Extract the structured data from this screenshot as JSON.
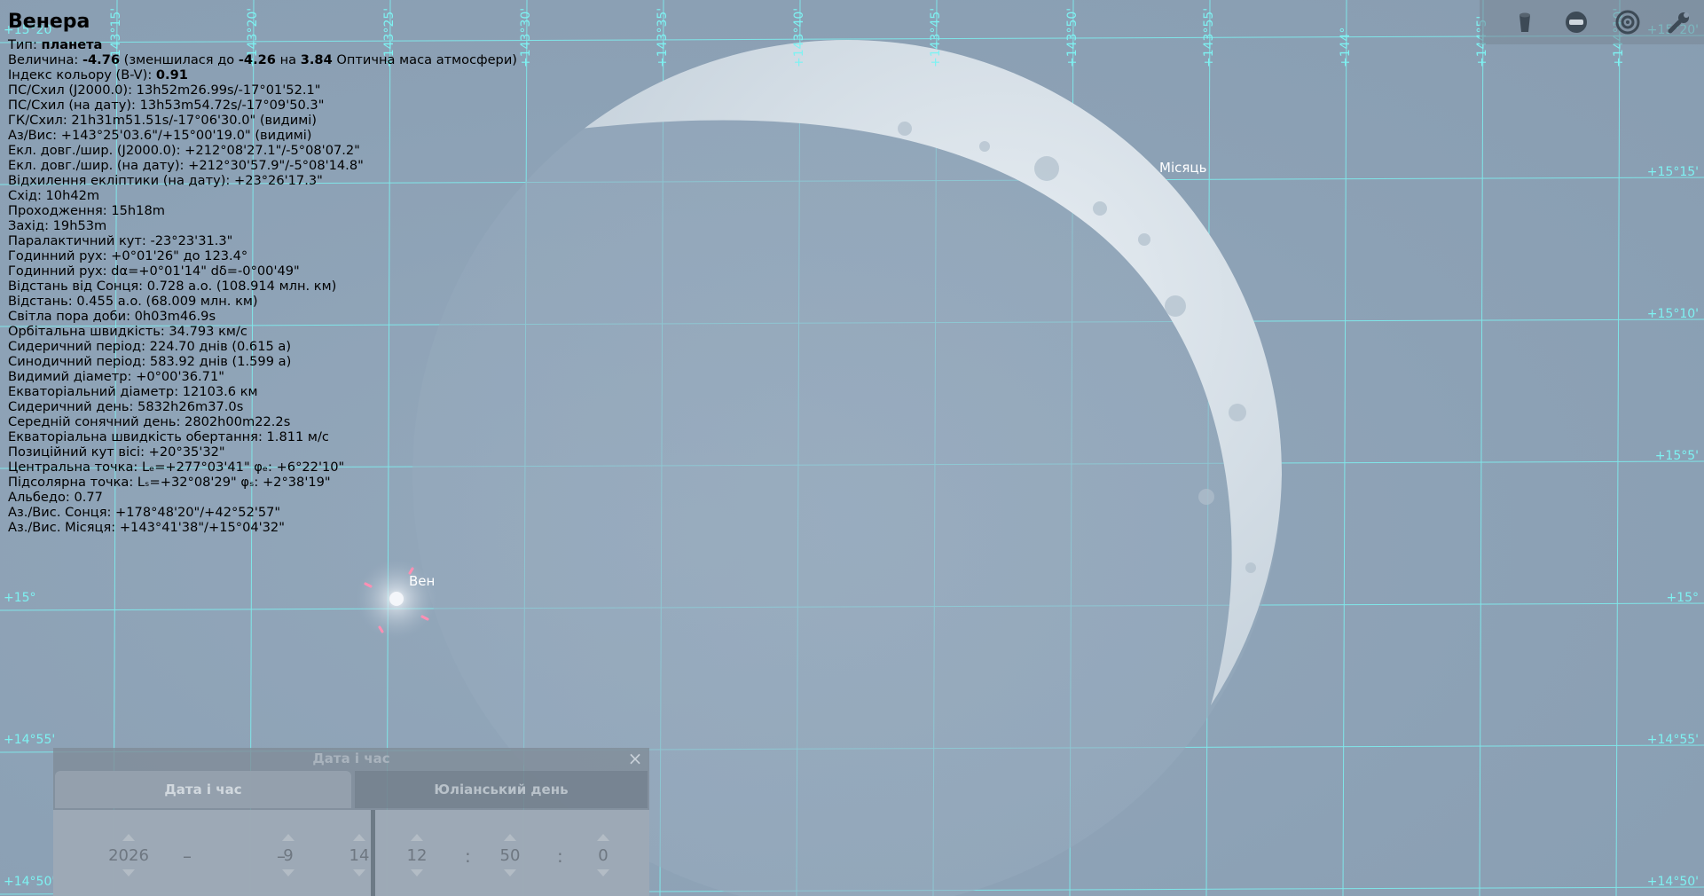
{
  "info": {
    "title": "Венера",
    "lines": [
      {
        "pre": "Тип: ",
        "bold": "планета",
        "post": ""
      },
      {
        "pre": "Величина: ",
        "bold": "-4.76",
        "post": " (зменшилася до ",
        "bold2": "-4.26",
        "post2": " на ",
        "bold3": "3.84",
        "post3": " Оптична маса атмосфери)"
      },
      {
        "pre": "Індекс кольору (B-V): ",
        "bold": "0.91",
        "post": ""
      },
      {
        "pre": "ПС/Схил (J2000.0): 13h52m26.99s/-17°01'52.1\""
      },
      {
        "pre": "ПС/Схил (на дату): 13h53m54.72s/-17°09'50.3\""
      },
      {
        "pre": "ГК/Схил: 21h31m51.51s/-17°06'30.0\" (видимі)"
      },
      {
        "pre": "Аз/Вис: +143°25'03.6\"/+15°00'19.0\" (видимі)"
      },
      {
        "pre": "Екл. довг./шир. (J2000.0): +212°08'27.1\"/-5°08'07.2\""
      },
      {
        "pre": "Екл. довг./шир. (на дату): +212°30'57.9\"/-5°08'14.8\""
      },
      {
        "pre": "Відхилення екліптики (на дату): +23°26'17.3\""
      },
      {
        "pre": "Схід: 10h42m"
      },
      {
        "pre": "Проходження: 15h18m"
      },
      {
        "pre": "Захід: 19h53m"
      },
      {
        "pre": "Паралактичний кут: -23°23'31.3\""
      },
      {
        "pre": "Годинний рух: +0°01'26\" до 123.4°"
      },
      {
        "pre": "Годинний рух: dα=+0°01'14\" dδ=-0°00'49\""
      },
      {
        "pre": "Відстань від Сонця: 0.728 а.о. (108.914 млн. км)"
      },
      {
        "pre": "Відстань: 0.455 а.о. (68.009 млн. км)"
      },
      {
        "pre": "Світла пора доби: 0h03m46.9s"
      },
      {
        "pre": "Орбітальна швидкість: 34.793 км/с"
      },
      {
        "pre": "Сидеричний період: 224.70 днів (0.615 а)"
      },
      {
        "pre": "Синодичний період: 583.92 днів (1.599 а)"
      },
      {
        "pre": "Видимий діаметр: +0°00'36.71\""
      },
      {
        "pre": "Екваторіальний діаметр: 12103.6 км"
      },
      {
        "pre": "Сидеричний день: 5832h26m37.0s"
      },
      {
        "pre": "Середній сонячний день: 2802h00m22.2s"
      },
      {
        "pre": "Екваторіальна швидкість обертання: 1.811 м/с"
      },
      {
        "pre": "Позиційний кут вісі: +20°35'32\""
      },
      {
        "pre": "Центральна точка: Lₑ=+277°03'41\" φₑ: +6°22'10\""
      },
      {
        "pre": "Підсолярна точка: Lₛ=+32°08'29\" φₛ: +2°38'19\""
      },
      {
        "pre": "Альбедо: 0.77"
      },
      {
        "pre": "Аз./Вис. Сонця: +178°48'20\"/+42°52'57\""
      },
      {
        "pre": "Аз./Вис. Місяця: +143°41'38\"/+15°04'32\""
      }
    ]
  },
  "sky": {
    "moon_label": "Місяць",
    "venus_label": "Вен",
    "colors": {
      "grid": "#7ef2f2",
      "sky": "#8fa3b6",
      "moon_lit": "#d9e2ea"
    }
  },
  "grid": {
    "azimuth_labels": [
      "+143°15'",
      "+143°20'",
      "+143°25'",
      "+143°30'",
      "+143°35'",
      "+143°40'",
      "+143°45'",
      "+143°50'",
      "+143°55'",
      "+144°",
      "+144°5'",
      "+144°10'"
    ],
    "altitude_labels_right": [
      "+15°20'",
      "+15°15'",
      "+15°10'",
      "+15°5'",
      "+15°",
      "+14°55'",
      "+14°50'"
    ],
    "altitude_labels_left": [
      "+15°20'",
      "+15°",
      "+14°55'",
      "+14°50'"
    ]
  },
  "toolbar": {
    "buttons": [
      {
        "icon": "trash-can-icon"
      },
      {
        "icon": "stop-icon"
      },
      {
        "icon": "target-icon"
      },
      {
        "icon": "wrench-icon"
      }
    ]
  },
  "dialog": {
    "title": "Дата і час",
    "close": "×",
    "tab_date": "Дата і час",
    "tab_jd": "Юліанський день",
    "year": "2026",
    "month": "9",
    "day": "14",
    "hour": "12",
    "minute": "50",
    "second": "0",
    "date_sep": "–",
    "time_sep": ":"
  }
}
